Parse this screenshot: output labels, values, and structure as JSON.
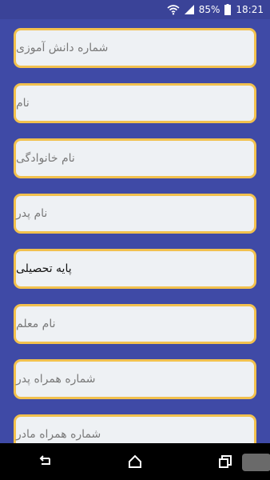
{
  "status_bar": {
    "battery": "85%",
    "time": "18:21",
    "icons": [
      "wifi-icon",
      "cell-signal-icon",
      "battery-icon"
    ]
  },
  "form": {
    "fields": [
      {
        "label": "شماره دانش آموزی",
        "kind": "input"
      },
      {
        "label": "نام",
        "kind": "input"
      },
      {
        "label": "نام خانوادگی",
        "kind": "input"
      },
      {
        "label": "نام پدر",
        "kind": "input"
      },
      {
        "label": "پایه تحصیلی",
        "kind": "select"
      },
      {
        "label": "نام معلم",
        "kind": "input"
      },
      {
        "label": "شماره همراه پدر",
        "kind": "input"
      },
      {
        "label": "شماره همراه مادر",
        "kind": "input"
      }
    ]
  },
  "nav_bar": {
    "icons": [
      "back-icon",
      "home-icon",
      "recent-apps-icon"
    ]
  },
  "colors": {
    "background": "#3f4aa6",
    "field_border": "#f2c14e",
    "field_fill": "#eef1f4"
  }
}
